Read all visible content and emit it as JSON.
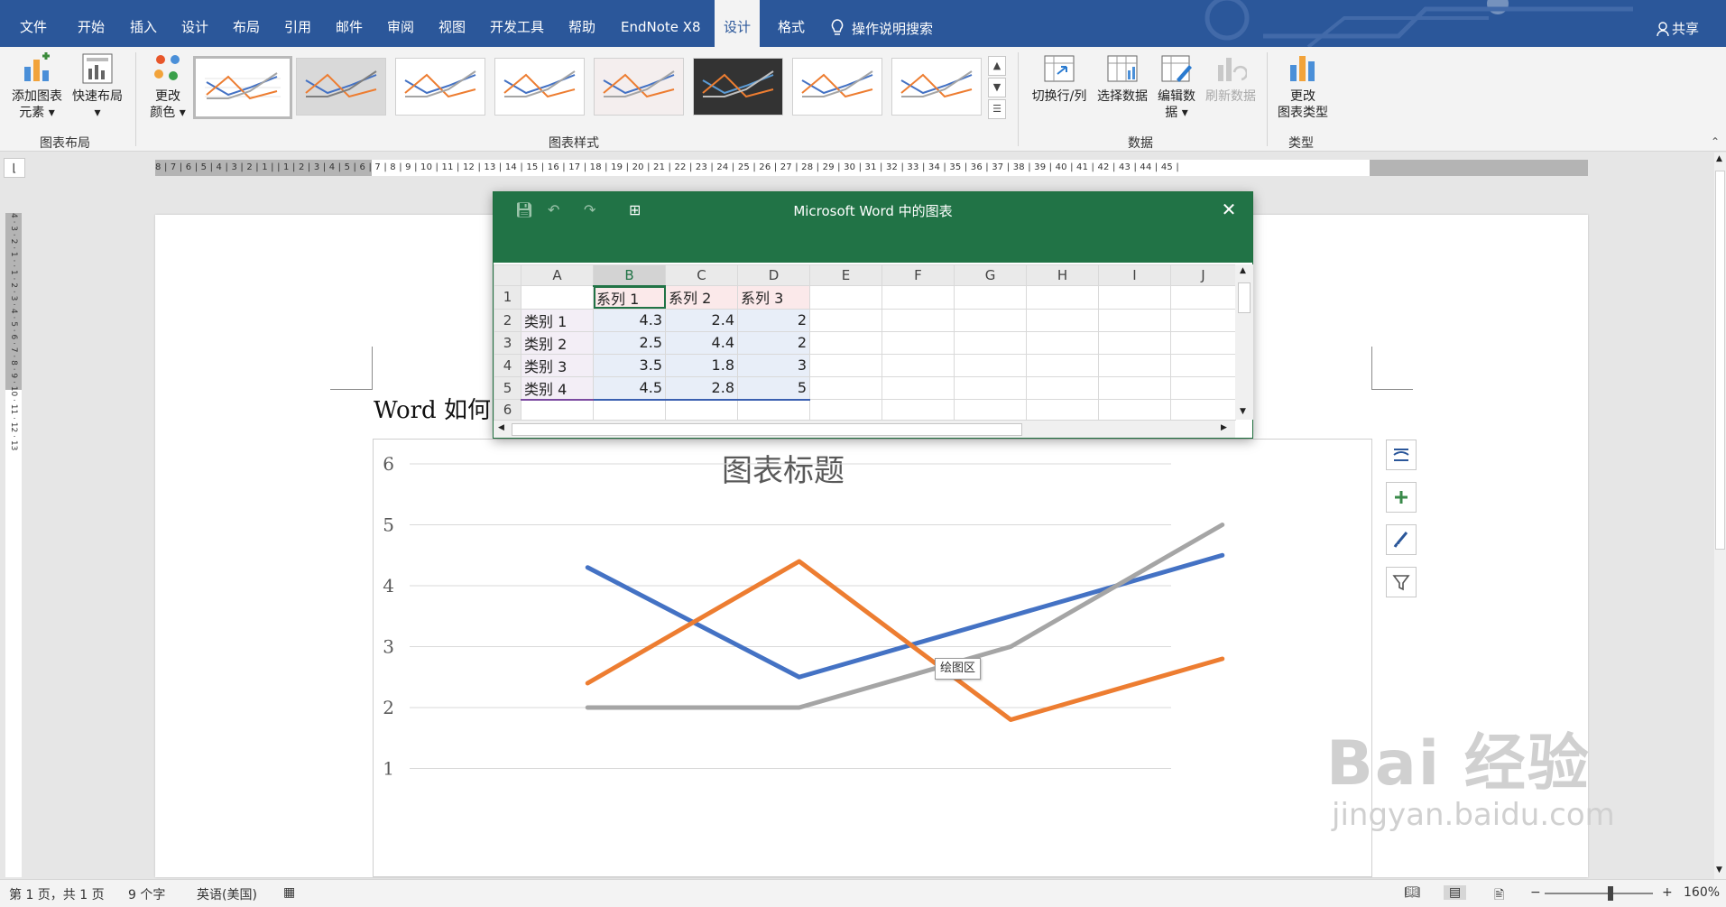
{
  "tabs": [
    {
      "label": "文件",
      "active": false
    },
    {
      "label": "开始",
      "active": false
    },
    {
      "label": "插入",
      "active": false
    },
    {
      "label": "设计",
      "active": false
    },
    {
      "label": "布局",
      "active": false
    },
    {
      "label": "引用",
      "active": false
    },
    {
      "label": "邮件",
      "active": false
    },
    {
      "label": "审阅",
      "active": false
    },
    {
      "label": "视图",
      "active": false
    },
    {
      "label": "开发工具",
      "active": false
    },
    {
      "label": "帮助",
      "active": false
    },
    {
      "label": "EndNote X8",
      "active": false
    },
    {
      "label": "设计",
      "active": true
    },
    {
      "label": "格式",
      "active": false
    }
  ],
  "tell_me": "操作说明搜索",
  "share": "共享",
  "ribbon": {
    "add_element": "添加图表\n元素",
    "quick_layout": "快速布局",
    "group_layout": "图表布局",
    "change_colors": "更改\n颜色",
    "group_styles": "图表样式",
    "switch_row_col": "切换行/列",
    "select_data": "选择数据",
    "edit_data": "编辑数\n据",
    "refresh_data": "刷新数据",
    "group_data": "数据",
    "change_type": "更改\n图表类型",
    "group_type": "类型"
  },
  "ruler_numbers": "8 | 7 | 6 | 5 | 4 | 3 | 2 | 1 |   | 1 | 2 | 3 | 4 | 5 | 6 | 7 | 8 | 9 | 10 | 11 | 12 | 13 | 14 | 15 | 16 | 17 | 18 | 19 | 20 | 21 | 22 | 23 | 24 | 25 | 26 | 27 | 28 | 29 | 30 | 31 | 32 | 33 | 34 | 35 | 36 | 37 | 38 | 39 | 40 | 41 | 42 | 43 | 44 | 45 |",
  "vruler_numbers": "4 · 3 · 2 · 1 ·   · 1 · 2 · 3 · 4 · 5 · 6 · 7 · 8 · 9 · 10 · 11 · 12 · 13",
  "document": {
    "heading": "Word 如何"
  },
  "excel": {
    "title": "Microsoft Word 中的图表",
    "columns": [
      "A",
      "B",
      "C",
      "D",
      "E",
      "F",
      "G",
      "H",
      "I",
      "J"
    ],
    "rows": [
      {
        "n": "1",
        "cells": [
          "",
          "系列 1",
          "系列 2",
          "系列 3"
        ]
      },
      {
        "n": "2",
        "cells": [
          "类别 1",
          "4.3",
          "2.4",
          "2"
        ]
      },
      {
        "n": "3",
        "cells": [
          "类别 2",
          "2.5",
          "4.4",
          "2"
        ]
      },
      {
        "n": "4",
        "cells": [
          "类别 3",
          "3.5",
          "1.8",
          "3"
        ]
      },
      {
        "n": "5",
        "cells": [
          "类别 4",
          "4.5",
          "2.8",
          "5"
        ]
      },
      {
        "n": "6",
        "cells": [
          "",
          "",
          "",
          ""
        ]
      }
    ]
  },
  "chart_tooltip": "绘图区",
  "chart_data": {
    "type": "line",
    "title": "图表标题",
    "categories": [
      "类别 1",
      "类别 2",
      "类别 3",
      "类别 4"
    ],
    "series": [
      {
        "name": "系列 1",
        "values": [
          4.3,
          2.5,
          3.5,
          4.5
        ],
        "color": "#4472c4"
      },
      {
        "name": "系列 2",
        "values": [
          2.4,
          4.4,
          1.8,
          2.8
        ],
        "color": "#ed7d31"
      },
      {
        "name": "系列 3",
        "values": [
          2,
          2,
          3,
          5
        ],
        "color": "#a5a5a5"
      }
    ],
    "y_ticks": [
      "1",
      "2",
      "3",
      "4",
      "5",
      "6"
    ],
    "ylim": [
      0,
      6
    ],
    "grid": true
  },
  "status": {
    "page": "第 1 页，共 1 页",
    "words": "9 个字",
    "language": "英语(美国)",
    "zoom": "160%",
    "zoom_minus": "−",
    "zoom_plus": "+"
  },
  "watermark": {
    "brand": "Bai 经验",
    "url": "jingyan.baidu.com"
  },
  "colors": {
    "word_blue": "#2b579a",
    "excel_green": "#217346"
  }
}
